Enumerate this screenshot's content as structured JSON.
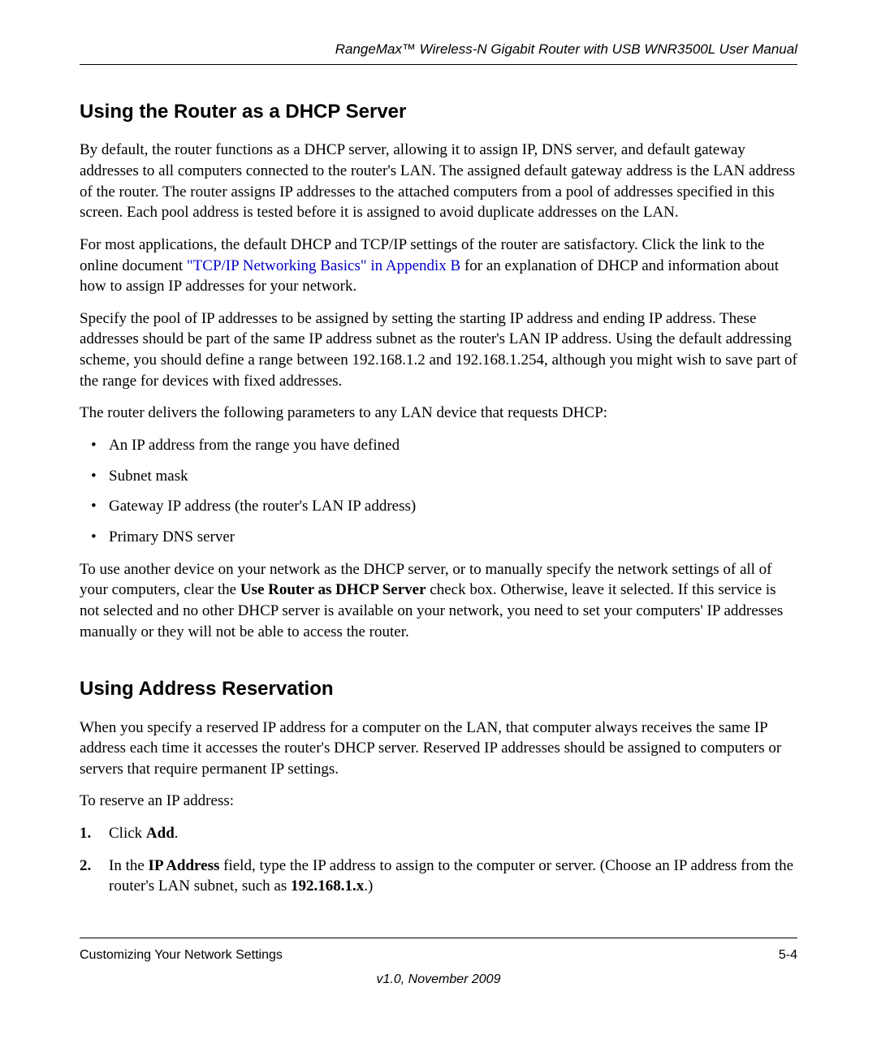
{
  "header": {
    "title": "RangeMax™ Wireless-N Gigabit Router with USB WNR3500L User Manual"
  },
  "section1": {
    "heading": "Using the Router as a DHCP Server",
    "para1": "By default, the router functions as a DHCP server, allowing it to assign IP, DNS server, and default gateway addresses to all computers connected to the router's LAN. The assigned default gateway address is the LAN address of the router. The router assigns IP addresses to the attached computers from a pool of addresses specified in this screen. Each pool address is tested before it is assigned to avoid duplicate addresses on the LAN.",
    "para2_a": "For most applications, the default DHCP and TCP/IP settings of the router are satisfactory. Click the link to the online document ",
    "para2_link": "\"TCP/IP Networking Basics\" in Appendix B",
    "para2_b": " for an explanation of DHCP and information about how to assign IP addresses for your network.",
    "para3": "Specify the pool of IP addresses to be assigned by setting the starting IP address and ending IP address. These addresses should be part of the same IP address subnet as the router's LAN IP address. Using the default addressing scheme, you should define a range between 192.168.1.2 and 192.168.1.254, although you might wish to save part of the range for devices with fixed addresses.",
    "para4": "The router delivers the following parameters to any LAN device that requests DHCP:",
    "bullets": {
      "b1": "An IP address from the range you have defined",
      "b2": "Subnet mask",
      "b3": "Gateway IP address (the router's LAN IP address)",
      "b4": "Primary DNS server"
    },
    "para5_a": "To use another device on your network as the DHCP server, or to manually specify the network settings of all of your computers, clear the ",
    "para5_bold": "Use Router as DHCP Server",
    "para5_b": " check box. Otherwise, leave it selected. If this service is not selected and no other DHCP server is available on your network, you need to set your computers' IP addresses manually or they will not be able to access the router."
  },
  "section2": {
    "heading": "Using Address Reservation",
    "para1": "When you specify a reserved IP address for a computer on the LAN, that computer always receives the same IP address each time it accesses the router's DHCP server. Reserved IP addresses should be assigned to computers or servers that require permanent IP settings.",
    "para2": "To reserve an IP address:",
    "step1_a": "Click ",
    "step1_bold": "Add",
    "step1_b": ".",
    "step2_a": "In the ",
    "step2_bold1": "IP Address",
    "step2_b": " field, type the IP address to assign to the computer or server. (Choose an IP address from the router's LAN subnet, such as ",
    "step2_bold2": "192.168.1.x",
    "step2_c": ".)"
  },
  "footer": {
    "left": "Customizing Your Network Settings",
    "right": "5-4",
    "version": "v1.0, November 2009"
  }
}
